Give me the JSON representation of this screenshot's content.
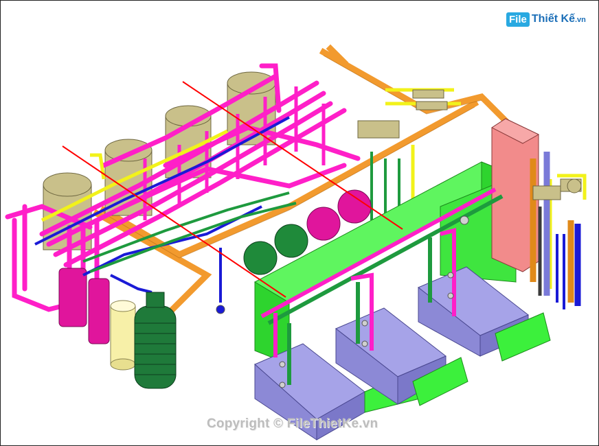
{
  "logo": {
    "box": "File",
    "rest": "Thiết Kế",
    "suffix": ".vn"
  },
  "copyright": "Copyright © FileThietKe.vn",
  "colors": {
    "pipe_magenta": "#ff1fc8",
    "pipe_orange": "#f29a2e",
    "duct_green": "#3cf03c",
    "tank_olive": "#c9c08a",
    "chiller_lavender": "#a6a3e8",
    "panel_salmon": "#f28b8b",
    "vessel_dark_green": "#1f7a3a",
    "pipe_blue": "#1a1ad6",
    "pipe_yellow": "#f2f21a",
    "section_line_red": "#ff0000"
  },
  "icons": [
    "logo-icon"
  ]
}
